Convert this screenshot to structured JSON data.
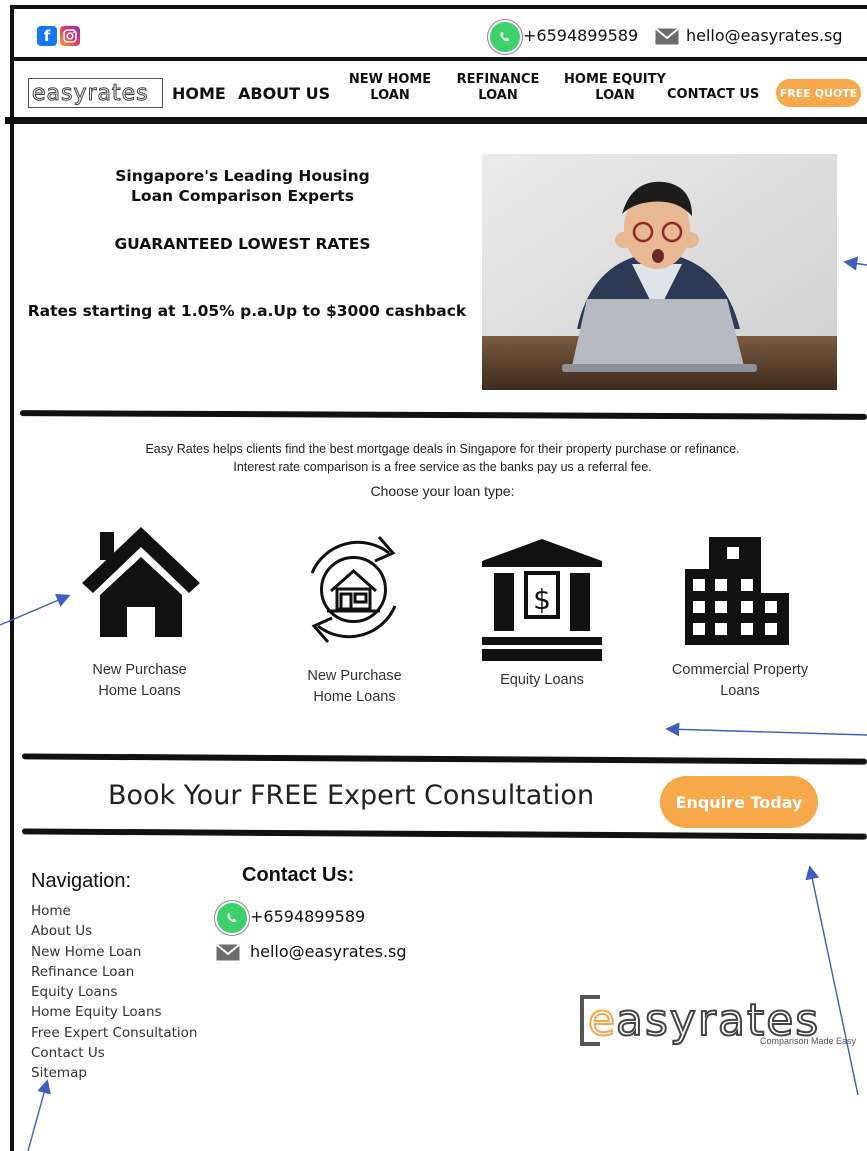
{
  "topbar": {
    "phone": "+6594899589",
    "email": "hello@easyrates.sg"
  },
  "brand": {
    "logo_text": "easyrates",
    "tagline": "Comparison Made Easy"
  },
  "nav": {
    "home": "HOME",
    "about": "ABOUT US",
    "new_home_loan_1": "NEW HOME",
    "new_home_loan_2": "LOAN",
    "refinance_1": "REFINANCE",
    "refinance_2": "LOAN",
    "home_equity_1": "HOME EQUITY",
    "home_equity_2": "LOAN",
    "contact": "CONTACT US",
    "free_quote": "FREE QUOTE"
  },
  "hero": {
    "headline_1": "Singapore's Leading Housing",
    "headline_2": "Loan Comparison Experts",
    "guarantee": "GUARANTEED LOWEST RATES",
    "rates": "Rates starting at 1.05% p.a.Up to $3000 cashback"
  },
  "intro": {
    "line_1": "Easy Rates helps clients find the best mortgage deals in Singapore for their property purchase or refinance.",
    "line_2": "Interest rate comparison is a free service as the banks pay us a referral fee.",
    "choose": "Choose your loan type:"
  },
  "loan_types": [
    {
      "icon": "house-icon",
      "label_1": "New Purchase",
      "label_2": "Home Loans"
    },
    {
      "icon": "refinance-house-icon",
      "label_1": "New Purchase",
      "label_2": "Home Loans"
    },
    {
      "icon": "bank-icon",
      "label_1": "Equity Loans",
      "label_2": ""
    },
    {
      "icon": "building-icon",
      "label_1": "Commercial Property",
      "label_2": "Loans"
    }
  ],
  "cta": {
    "text": "Book Your FREE Expert Consultation",
    "button": "Enquire Today"
  },
  "footer": {
    "nav_title": "Navigation:",
    "links": [
      "Home",
      "About Us",
      "New Home Loan",
      "Refinance Loan",
      "Equity Loans",
      "Home Equity Loans",
      "Free Expert Consultation",
      "Contact Us",
      "Sitemap"
    ],
    "contact_title": "Contact Us:",
    "phone": "+6594899589",
    "email": "hello@easyrates.sg"
  },
  "colors": {
    "accent": "#f7a84a",
    "whatsapp": "#3dd16e",
    "annotation_arrow": "#3e5fbf"
  }
}
